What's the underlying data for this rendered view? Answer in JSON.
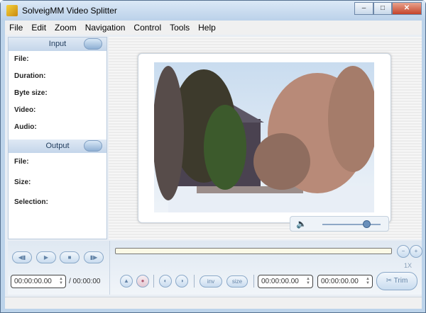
{
  "window": {
    "title": "SolveigMM Video Splitter",
    "minimize": "–",
    "maximize": "□",
    "close": "✕"
  },
  "menu": [
    "File",
    "Edit",
    "Zoom",
    "Navigation",
    "Control",
    "Tools",
    "Help"
  ],
  "input": {
    "header": "Input",
    "fields": [
      "File:",
      "Duration:",
      "Byte size:",
      "Video:",
      "Audio:"
    ]
  },
  "output": {
    "header": "Output",
    "fields": [
      "File:",
      "Size:",
      "Selection:"
    ]
  },
  "playback": {
    "prev": "◀▮",
    "play": "▶",
    "stop": "■",
    "next": "▮▶"
  },
  "time": {
    "current": "00:00:00.00",
    "total": "/ 00:00:00"
  },
  "zoom": {
    "minus": "−",
    "plus": "+",
    "level": "1X"
  },
  "edit": {
    "inv_label": "inv",
    "size_label": "size",
    "start_time": "00:00:00.00",
    "end_time": "00:00:00.00",
    "trim_label": "Trim"
  },
  "volume": {
    "level": 0.75
  }
}
